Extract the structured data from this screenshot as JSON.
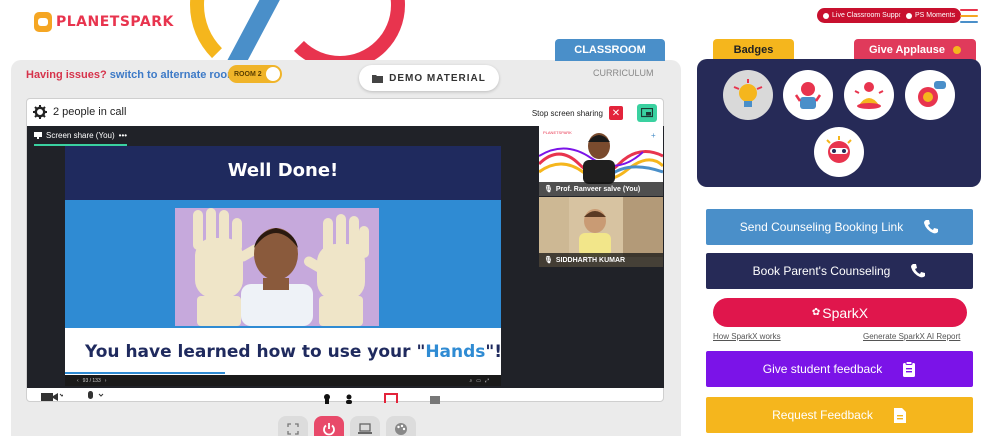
{
  "brand": {
    "logo_text": "PLANETSPARK"
  },
  "header": {
    "live_support_label": "Live Classroom Support",
    "ps_moments_label": "PS Moments",
    "hamburger_colors": [
      "#e8344e",
      "#f5a623",
      "#4a8fc9"
    ]
  },
  "tabs": {
    "classroom": "CLASSROOM",
    "curriculum": "CURRICULUM"
  },
  "issues": {
    "text": "Having issues?",
    "link": "switch to alternate room"
  },
  "room_toggle": {
    "label": "ROOM 2"
  },
  "demo_material": {
    "label": "DEMO MATERIAL"
  },
  "call": {
    "people_count_label": "2 people in call",
    "stop_sharing_label": "Stop screen sharing",
    "screen_share_label": "Screen share (You)"
  },
  "slide": {
    "title": "Well Done!",
    "caption_prefix": "You have learned how to use your \"",
    "caption_highlight": "Hands",
    "caption_suffix": "\"!",
    "page_indicator": "93 / 133"
  },
  "participants": [
    {
      "name": "Prof. Ranveer salve (You)"
    },
    {
      "name": "SIDDHARTH KUMAR"
    }
  ],
  "right": {
    "badges_tab": "Badges",
    "give_applause_tab": "Give Applause",
    "send_counseling": "Send Counseling Booking Link",
    "book_parents": "Book Parent's Counseling",
    "sparkx": "SparkX",
    "how_sparkx": "How SparkX works",
    "generate_report": "Generate SparkX AI Report",
    "give_feedback": "Give student feedback",
    "request_feedback": "Request Feedback"
  },
  "colors": {
    "accent_blue": "#4a8fc9",
    "navy": "#262a57",
    "pink": "#e0164c",
    "purple": "#7b13e8",
    "yellow": "#f5b61d"
  }
}
